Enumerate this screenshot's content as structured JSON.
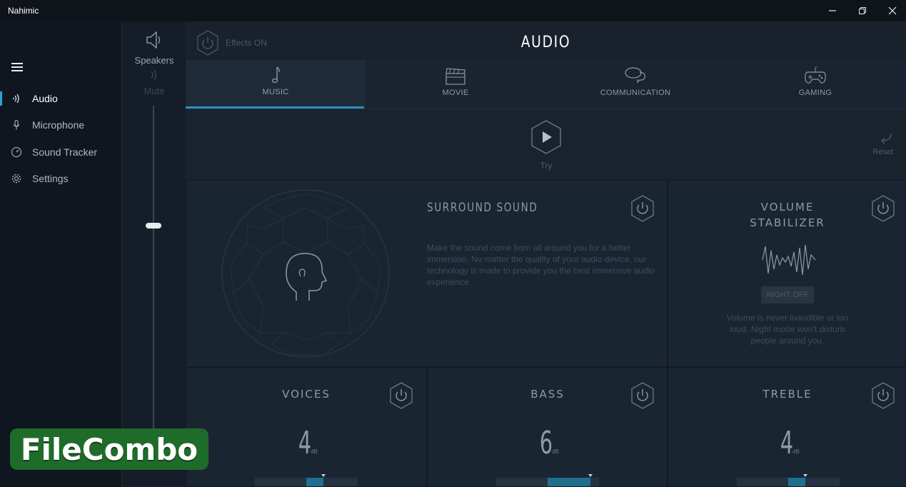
{
  "window": {
    "title": "Nahimic",
    "minimize": "—",
    "restore": "❐",
    "close": "✕"
  },
  "nav": {
    "items": [
      {
        "label": "Audio",
        "icon": "audio-waves-icon",
        "active": true
      },
      {
        "label": "Microphone",
        "icon": "microphone-icon",
        "active": false
      },
      {
        "label": "Sound Tracker",
        "icon": "compass-icon",
        "active": false
      },
      {
        "label": "Settings",
        "icon": "gear-icon",
        "active": false
      }
    ]
  },
  "device": {
    "name": "Speakers",
    "mute_label": "Mute",
    "volume_level": 0.6
  },
  "header": {
    "effects_label": "Effects ON",
    "title": "AUDIO"
  },
  "tabs": [
    {
      "label": "MUSIC",
      "icon": "music-note-icon",
      "active": true
    },
    {
      "label": "MOVIE",
      "icon": "clapperboard-icon",
      "active": false
    },
    {
      "label": "COMMUNICATION",
      "icon": "speech-bubbles-icon",
      "active": false
    },
    {
      "label": "GAMING",
      "icon": "gamepad-icon",
      "active": false
    }
  ],
  "try": {
    "label": "Try"
  },
  "reset": {
    "label": "Reset"
  },
  "surround": {
    "title": "SURROUND SOUND",
    "description": "Make the sound come from all around you for a better immersion. No matter the quality of your audio device, our technology is made to provide you the best immersive audio experience."
  },
  "stabilizer": {
    "title_line1": "VOLUME",
    "title_line2": "STABILIZER",
    "night_label": "NIGHT OFF",
    "description": "Volume is never inaudible or too loud. Night mode won't disturb people around you."
  },
  "equalizer": [
    {
      "title": "VOICES",
      "value": "4",
      "unit": "dB",
      "level": 0.5
    },
    {
      "title": "BASS",
      "value": "6",
      "unit": "dB",
      "level": 0.75
    },
    {
      "title": "TREBLE",
      "value": "4",
      "unit": "dB",
      "level": 0.5
    }
  ],
  "watermark": {
    "text": "FileCombo"
  },
  "colors": {
    "accent": "#2c8fc4",
    "background": "#18212c",
    "nav": "#0f161f"
  }
}
